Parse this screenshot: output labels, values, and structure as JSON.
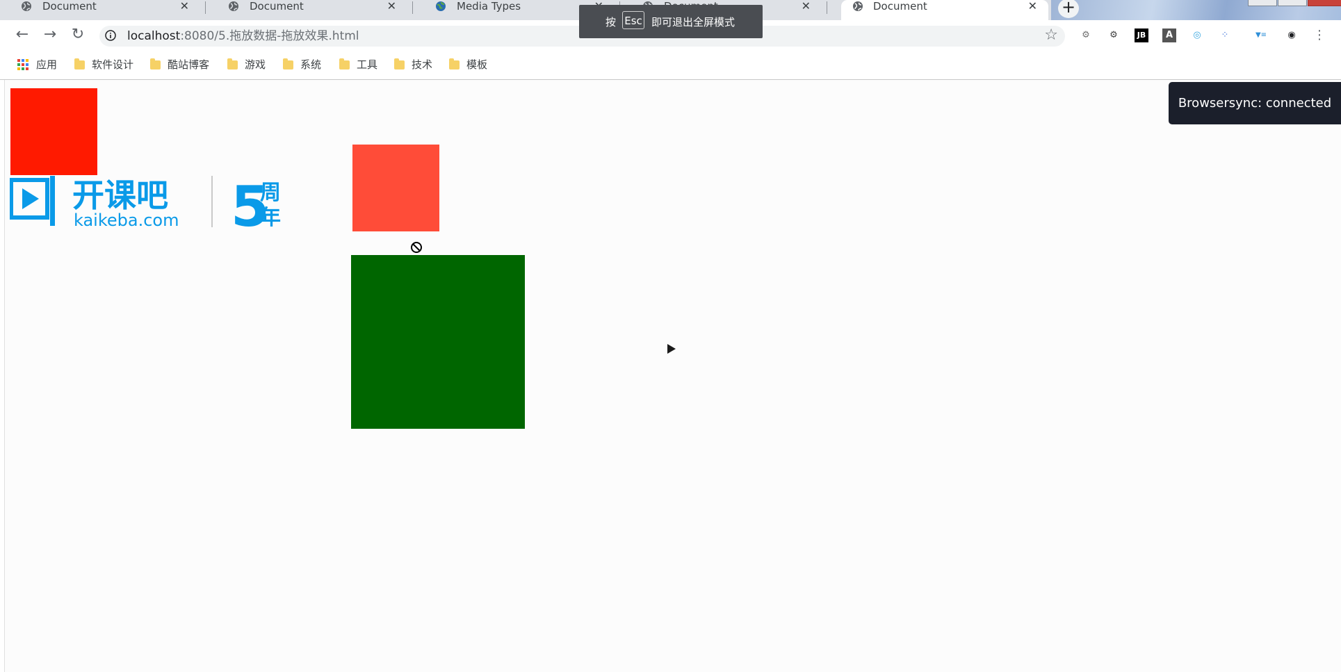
{
  "tabs": [
    {
      "title": "Document",
      "favicon": "globe-icon"
    },
    {
      "title": "Document",
      "favicon": "globe-icon"
    },
    {
      "title": "Media Types",
      "favicon": "mdn-globe-icon"
    },
    {
      "title": "Document",
      "favicon": "globe-icon"
    },
    {
      "title": "Document",
      "favicon": "globe-icon",
      "active": true
    }
  ],
  "toolbar": {
    "url_host": "localhost",
    "url_path": ":8080/5.拖放数据-拖放效果.html"
  },
  "bookmarks": {
    "apps_label": "应用",
    "folders": [
      "软件设计",
      "酷站博客",
      "游戏",
      "系统",
      "工具",
      "技术",
      "模板"
    ]
  },
  "fullscreen_toast": {
    "prefix": "按",
    "key": "Esc",
    "suffix": "即可退出全屏模式"
  },
  "logo": {
    "brand_cn": "开课吧",
    "brand_en": "kaikeba.com",
    "anniversary_num": "5",
    "anniversary_cn_top": "周",
    "anniversary_cn_bottom": "年",
    "color": "#0a9ae8"
  },
  "page": {
    "red_box_color": "#ff1a00",
    "drag_box_color": "#ff4c38",
    "drop_zone_color": "#006600"
  },
  "browsersync": {
    "message": "Browsersync: connected"
  }
}
